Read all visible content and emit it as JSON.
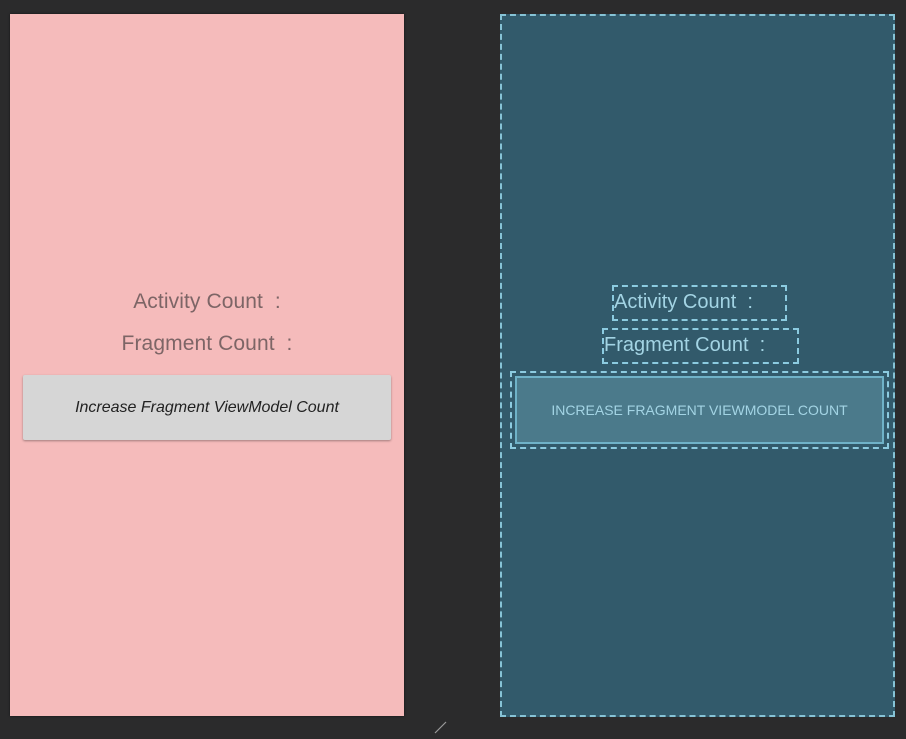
{
  "design": {
    "activity_label": "Activity Count  :",
    "fragment_label": "Fragment Count  :",
    "button_label": "Increase Fragment ViewModel Count"
  },
  "blueprint": {
    "activity_label": "Activity Count  :",
    "fragment_label": "Fragment Count  :",
    "button_label": "INCREASE FRAGMENT VIEWMODEL COUNT"
  },
  "colors": {
    "canvas_background": "#2b2b2c",
    "design_background": "#f5bbbb",
    "blueprint_background": "#325a6b",
    "blueprint_outline": "#8ccbe0"
  },
  "icons": {
    "resize_handle": "resize-handle-icon"
  }
}
